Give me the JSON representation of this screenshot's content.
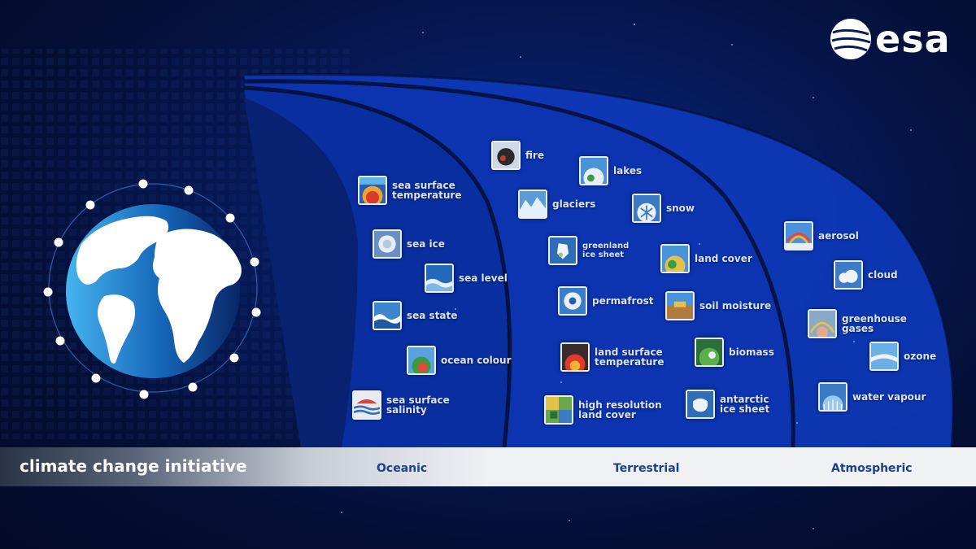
{
  "brand": {
    "name": "esa"
  },
  "banner": {
    "title": "climate change initiative"
  },
  "categories": [
    {
      "id": "oceanic",
      "label": "Oceanic"
    },
    {
      "id": "terrestrial",
      "label": "Terrestrial"
    },
    {
      "id": "atmospheric",
      "label": "Atmospheric"
    }
  ],
  "variables": {
    "oceanic": [
      {
        "label": "sea surface\ntemperature",
        "icon": "sea-surface-temperature-icon"
      },
      {
        "label": "sea ice",
        "icon": "sea-ice-icon"
      },
      {
        "label": "sea level",
        "icon": "sea-level-icon"
      },
      {
        "label": "sea state",
        "icon": "sea-state-icon"
      },
      {
        "label": "ocean colour",
        "icon": "ocean-colour-icon"
      },
      {
        "label": "sea surface\nsalinity",
        "icon": "sea-surface-salinity-icon"
      }
    ],
    "terrestrial": [
      {
        "label": "fire",
        "icon": "fire-icon"
      },
      {
        "label": "lakes",
        "icon": "lakes-icon"
      },
      {
        "label": "glaciers",
        "icon": "glaciers-icon"
      },
      {
        "label": "snow",
        "icon": "snow-icon"
      },
      {
        "label": "greenland\nice sheet",
        "icon": "greenland-ice-sheet-icon"
      },
      {
        "label": "land cover",
        "icon": "land-cover-icon"
      },
      {
        "label": "permafrost",
        "icon": "permafrost-icon"
      },
      {
        "label": "soil moisture",
        "icon": "soil-moisture-icon"
      },
      {
        "label": "land surface\ntemperature",
        "icon": "land-surface-temperature-icon"
      },
      {
        "label": "biomass",
        "icon": "biomass-icon"
      },
      {
        "label": "high resolution\nland cover",
        "icon": "high-resolution-land-cover-icon"
      },
      {
        "label": "antarctic\nice sheet",
        "icon": "antarctic-ice-sheet-icon"
      }
    ],
    "atmospheric": [
      {
        "label": "aerosol",
        "icon": "aerosol-icon"
      },
      {
        "label": "cloud",
        "icon": "cloud-icon"
      },
      {
        "label": "greenhouse\ngases",
        "icon": "greenhouse-gases-icon"
      },
      {
        "label": "ozone",
        "icon": "ozone-icon"
      },
      {
        "label": "water vapour",
        "icon": "water-vapour-icon"
      }
    ]
  },
  "colors": {
    "bandInner": "#0b2fa8",
    "bandMiddle": "#0d37b8",
    "bandOuter": "#0f3fc6",
    "categoryText": "#1d3f8f",
    "globeOcean": "#1a78c8"
  }
}
